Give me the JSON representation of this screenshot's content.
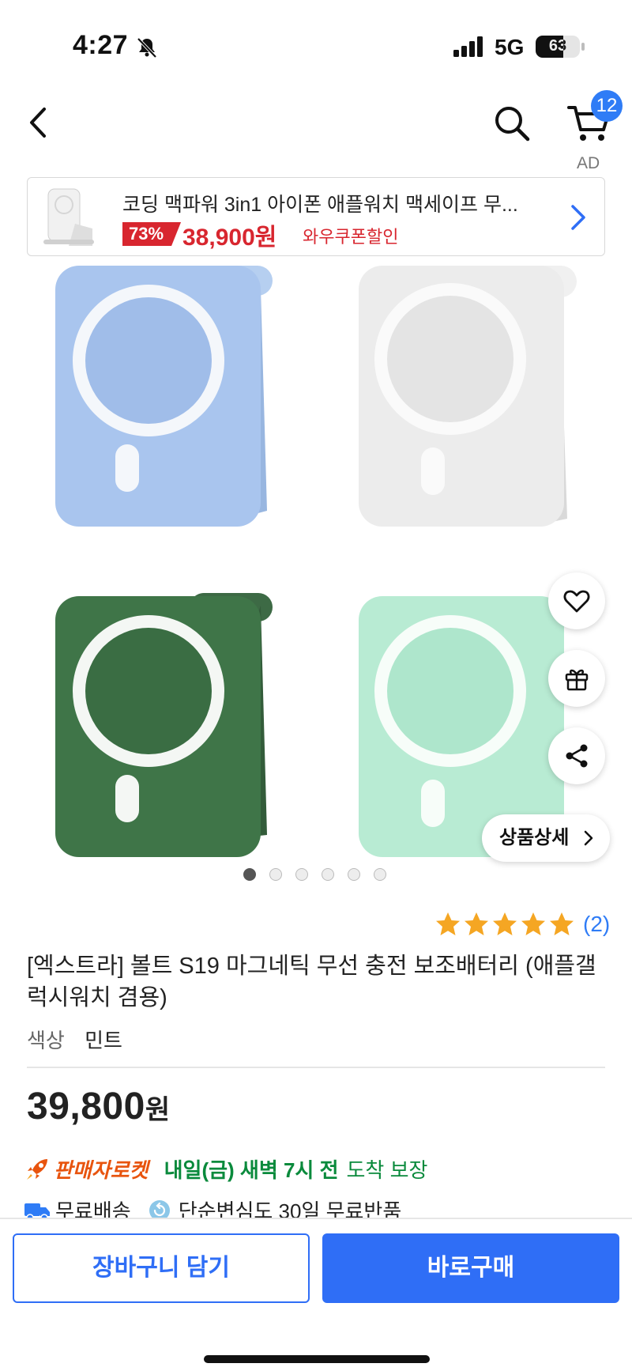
{
  "status_bar": {
    "time": "4:27",
    "network": "5G",
    "battery": "63",
    "icons": [
      "bell-muted-icon",
      "signal-icon",
      "battery-icon"
    ]
  },
  "nav": {
    "cart_badge": "12",
    "icons": [
      "back-icon",
      "search-icon",
      "cart-icon"
    ]
  },
  "ad": {
    "label": "AD",
    "title": "코딩 맥파워 3in1 아이폰 애플워치 맥세이프 무...",
    "discount": "73%",
    "price": "38,900원",
    "coupon": "와우쿠폰할인"
  },
  "gallery": {
    "detail_button": "상품상세",
    "dot_count": 6,
    "active_dot": 0,
    "colors": [
      "#a9c5ee",
      "#ececec",
      "#3f7548",
      "#b8ebd3"
    ],
    "icons": [
      "heart-icon",
      "gift-icon",
      "share-icon",
      "chevron-right-icon"
    ]
  },
  "product": {
    "rating_count": "(2)",
    "stars": 5,
    "title": "[엑스트라] 볼트 S19 마그네틱 무선 충전 보조배터리 (애플갤럭시워치 겸용)",
    "option_key": "색상",
    "option_value": "민트",
    "price": "39,800",
    "price_unit": "원"
  },
  "delivery": {
    "seller_rocket": "판매자로켓",
    "eta": "내일(금) 새벽 7시 전",
    "guarantee": "도착 보장",
    "free_shipping": "무료배송",
    "free_return": "단순변심도 30일 무료반품"
  },
  "actions": {
    "add_to_cart": "장바구니 담기",
    "buy_now": "바로구매"
  },
  "colors": {
    "accent": "#2f6ef6",
    "sale": "#d8262f",
    "delivery_green": "#0a8a3c",
    "rocket_orange": "#e8540e"
  }
}
